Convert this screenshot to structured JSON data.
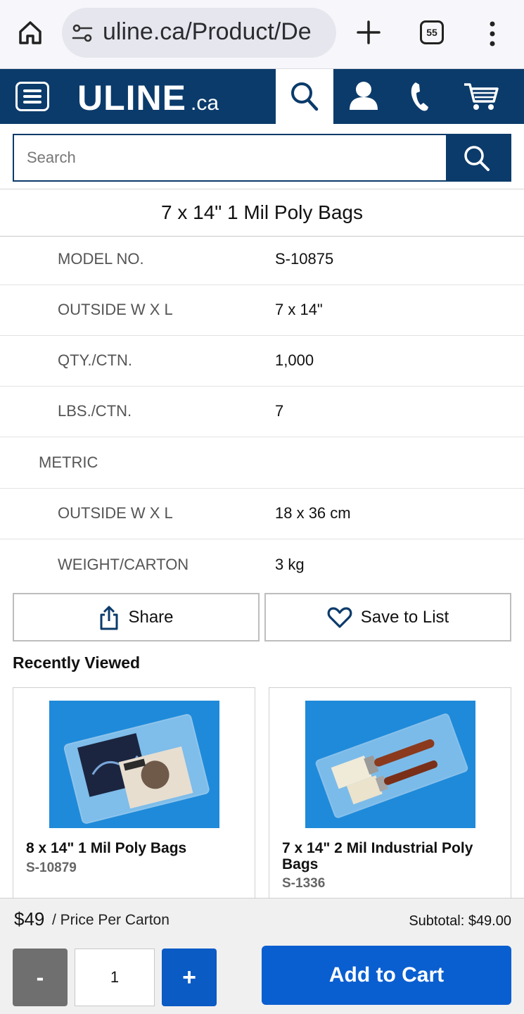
{
  "browser": {
    "url": "uline.ca/Product/De",
    "tab_count": "55"
  },
  "header": {
    "logo_main": "ULINE",
    "logo_tld": ".ca",
    "brand_color": "#0b3b6b"
  },
  "search": {
    "placeholder": "Search"
  },
  "product": {
    "title": "7 x 14\" 1 Mil Poly Bags",
    "specs": [
      {
        "label": "MODEL NO.",
        "value": "S-10875"
      },
      {
        "label": "OUTSIDE W X L",
        "value": "7 x 14\""
      },
      {
        "label": "QTY./CTN.",
        "value": "1,000"
      },
      {
        "label": "LBS./CTN.",
        "value": "7"
      },
      {
        "label": "METRIC",
        "value": ""
      },
      {
        "label": "OUTSIDE W X L",
        "value": "18 x 36 cm"
      },
      {
        "label": "WEIGHT/CARTON",
        "value": "3 kg"
      }
    ]
  },
  "actions": {
    "share_label": "Share",
    "save_label": "Save to List"
  },
  "recently_viewed": {
    "heading": "Recently Viewed",
    "items": [
      {
        "name": "8 x 14\" 1 Mil Poly Bags",
        "sku": "S-10879"
      },
      {
        "name": "7 x 14\" 2 Mil Industrial Poly Bags",
        "sku": "S-1336"
      }
    ]
  },
  "cart_bar": {
    "price": "$49",
    "price_per": "/ Price Per Carton",
    "subtotal": "Subtotal: $49.00",
    "minus_label": "-",
    "quantity": "1",
    "plus_label": "+",
    "add_to_cart_label": "Add to Cart",
    "cta_color": "#0a5fd0"
  }
}
